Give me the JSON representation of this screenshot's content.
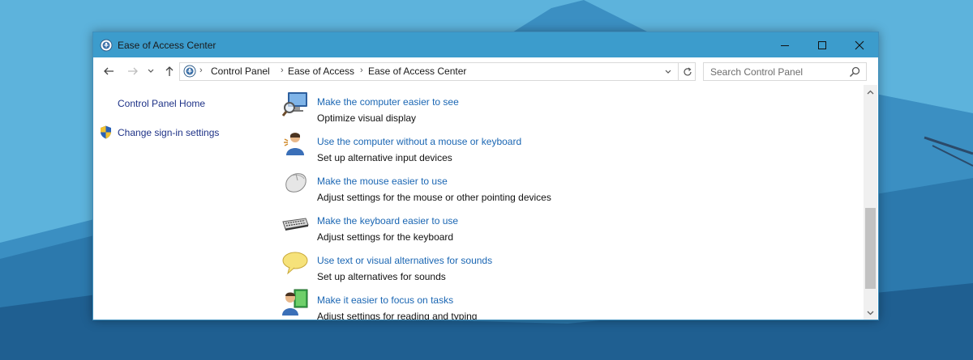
{
  "window": {
    "title": "Ease of Access Center",
    "controls": [
      "minimize-icon",
      "maximize-icon",
      "close-icon"
    ]
  },
  "navbar": {
    "breadcrumbs": [
      "Control Panel",
      "Ease of Access",
      "Ease of Access Center"
    ],
    "search_placeholder": "Search Control Panel"
  },
  "sidebar": {
    "items": [
      {
        "label": "Control Panel Home"
      },
      {
        "label": "Change sign-in settings",
        "icon": "shield-icon"
      }
    ]
  },
  "main": {
    "items": [
      {
        "link": "Make the computer easier to see",
        "desc": "Optimize visual display",
        "icon": "monitor-magnifier-icon"
      },
      {
        "link": "Use the computer without a mouse or keyboard",
        "desc": "Set up alternative input devices",
        "icon": "person-speaking-icon"
      },
      {
        "link": "Make the mouse easier to use",
        "desc": "Adjust settings for the mouse or other pointing devices",
        "icon": "mouse-icon"
      },
      {
        "link": "Make the keyboard easier to use",
        "desc": "Adjust settings for the keyboard",
        "icon": "keyboard-icon"
      },
      {
        "link": "Use text or visual alternatives for sounds",
        "desc": "Set up alternatives for sounds",
        "icon": "speech-bubble-icon"
      },
      {
        "link": "Make it easier to focus on tasks",
        "desc": "Adjust settings for reading and typing",
        "icon": "person-book-icon"
      }
    ]
  },
  "colors": {
    "titlebar": "#3c9ccc",
    "link": "#1a66b3",
    "sidebar_link": "#1e3287",
    "desktop": "#5aaed6"
  }
}
